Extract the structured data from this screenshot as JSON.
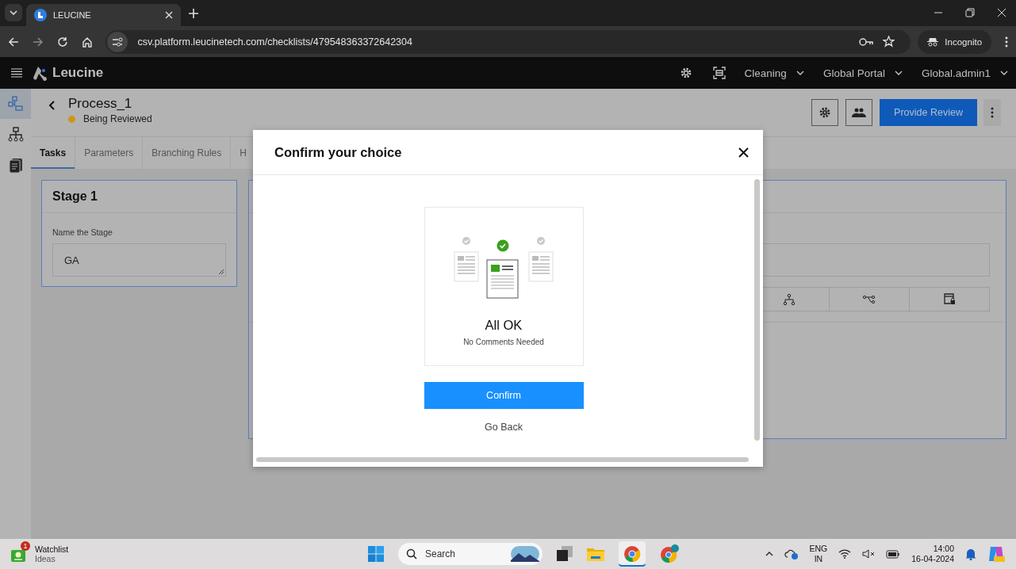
{
  "browser": {
    "tab_title": "LEUCINE",
    "url": "csv.platform.leucinetech.com/checklists/479548363372642304",
    "profile": "Incognito"
  },
  "app_header": {
    "brand": "Leucine",
    "menus": [
      {
        "label": "Cleaning"
      },
      {
        "label": "Global Portal"
      },
      {
        "label": "Global.admin1"
      }
    ]
  },
  "sidebar": {
    "items": [
      {
        "kind": "flow",
        "selected": true
      },
      {
        "kind": "hierarchy",
        "selected": false
      },
      {
        "kind": "report",
        "selected": false
      }
    ]
  },
  "process": {
    "title": "Process_1",
    "status": {
      "label": "Being Reviewed",
      "color": "#c99a17"
    },
    "primary_action": "Provide Review"
  },
  "tabs": [
    {
      "label": "Tasks",
      "selected": true
    },
    {
      "label": "Parameters",
      "selected": false
    },
    {
      "label": "Branching Rules",
      "selected": false
    },
    {
      "label": "H",
      "selected": false
    }
  ],
  "stage": {
    "title": "Stage 1",
    "field_label": "Name the Stage",
    "value": "GA"
  },
  "task_tools": [
    {
      "kind": "branch"
    },
    {
      "kind": "connect"
    },
    {
      "kind": "lock"
    }
  ],
  "modal": {
    "title": "Confirm your choice",
    "card_title": "All OK",
    "card_subtitle": "No Comments Needed",
    "confirm": "Confirm",
    "back": "Go Back"
  },
  "taskbar": {
    "widget": {
      "title": "Watchlist",
      "subtitle": "Ideas",
      "badge": "1"
    },
    "search_placeholder": "Search",
    "language": [
      "ENG",
      "IN"
    ],
    "time": "14:00",
    "date": "16-04-2024"
  }
}
